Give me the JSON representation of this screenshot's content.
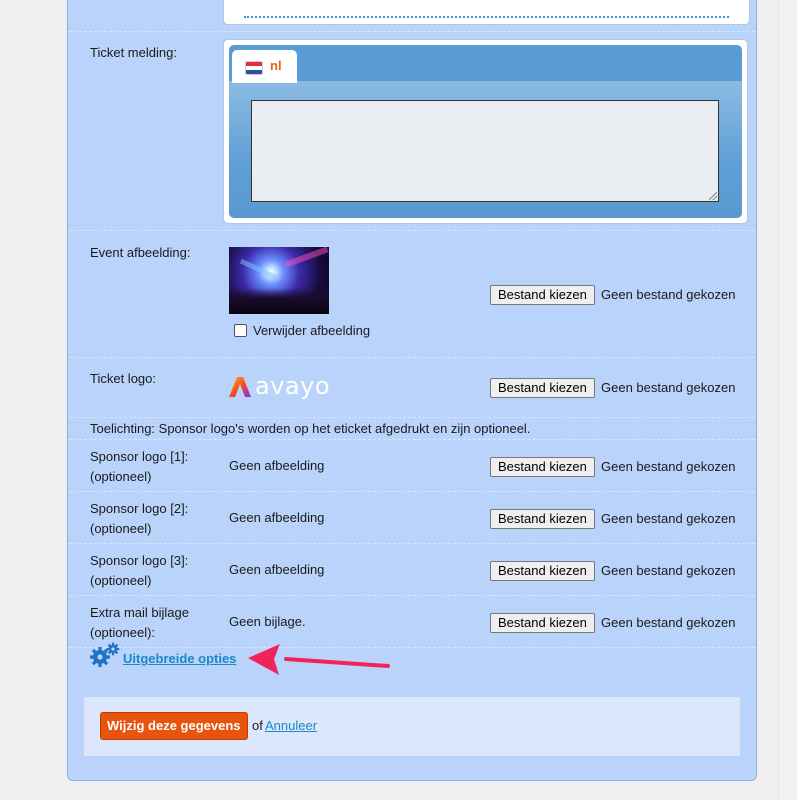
{
  "form": {
    "ticket_message": {
      "label": "Ticket melding:",
      "tab_label": "nl",
      "value": ""
    },
    "event_image": {
      "label": "Event afbeelding:",
      "remove_label": "Verwijder afbeelding",
      "remove_checked": false
    },
    "ticket_logo": {
      "label": "Ticket logo:",
      "logo_text": "avayo"
    },
    "note": "Toelichting: Sponsor logo's worden op het eticket afgedrukt en zijn optioneel.",
    "sponsors": [
      {
        "label_line1": "Sponsor logo [1]:",
        "label_line2": "(optioneel)",
        "value": "Geen afbeelding"
      },
      {
        "label_line1": "Sponsor logo [2]:",
        "label_line2": "(optioneel)",
        "value": "Geen afbeelding"
      },
      {
        "label_line1": "Sponsor logo [3]:",
        "label_line2": "(optioneel)",
        "value": "Geen afbeelding"
      }
    ],
    "extra_attachment": {
      "label_line1": "Extra mail bijlage",
      "label_line2": "(optioneel):",
      "value": "Geen bijlage."
    },
    "file_input": {
      "button_label": "Bestand kiezen",
      "status": "Geen bestand gekozen"
    },
    "advanced_options_link": "Uitgebreide opties"
  },
  "actions": {
    "submit_label": "Wijzig deze gegevens",
    "of_text": "of",
    "cancel_label": "Annuleer"
  },
  "colors": {
    "panel_bg": "#b9d3fa",
    "link": "#1a88c9",
    "submit_bg": "#e8530e",
    "annotation_arrow": "#f0245a",
    "tab_text": "#e8601c"
  },
  "icons": [
    "nl-flag-icon",
    "gear-icon",
    "checkbox-icon",
    "avayo-logo",
    "annotation-arrow-icon"
  ]
}
